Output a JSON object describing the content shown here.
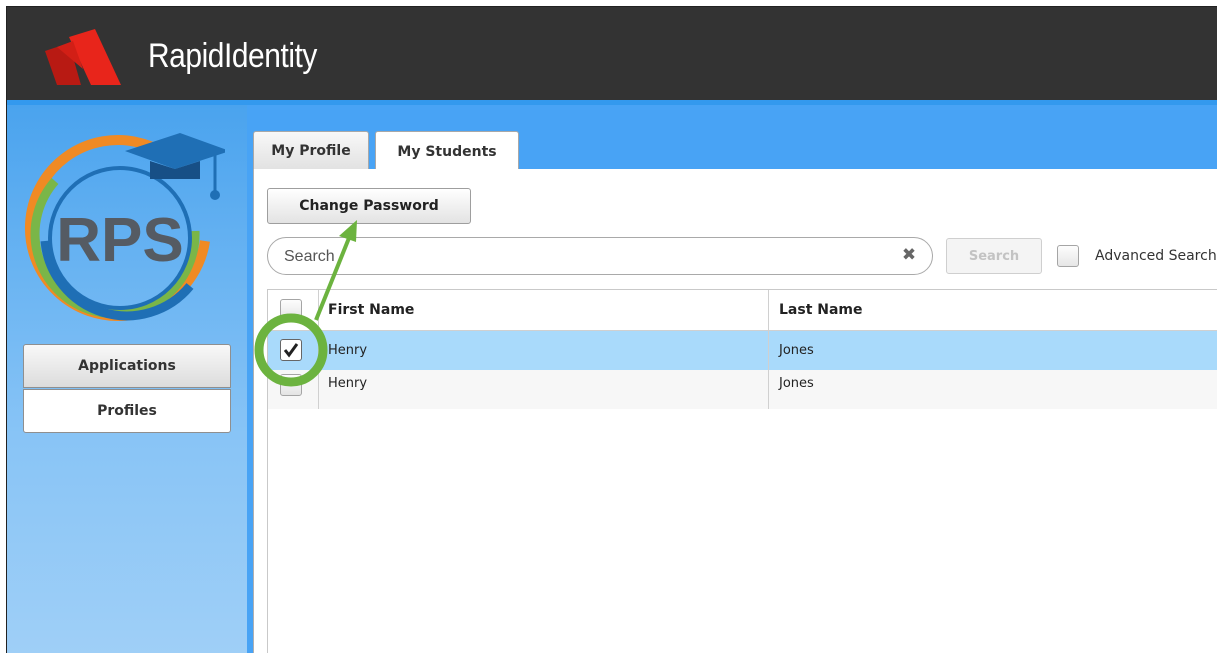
{
  "app": {
    "title": "RapidIdentity",
    "org_logo_text": "RPS"
  },
  "sidebar": {
    "items": [
      {
        "label": "Applications"
      },
      {
        "label": "Profiles"
      }
    ]
  },
  "tabs": [
    {
      "label": "My Profile",
      "active": false
    },
    {
      "label": "My Students",
      "active": true
    }
  ],
  "toolbar": {
    "change_password_label": "Change Password"
  },
  "search": {
    "placeholder": "Search",
    "button_label": "Search",
    "advanced_label": "Advanced Search"
  },
  "table": {
    "columns": [
      "First Name",
      "Last Name"
    ],
    "rows": [
      {
        "first": "Henry",
        "last": "Jones",
        "selected": true
      },
      {
        "first": "Henry",
        "last": "Jones",
        "selected": false
      }
    ]
  },
  "colors": {
    "topbar": "#333333",
    "brand_red": "#e8251b",
    "accent_blue": "#48a3f5",
    "selected_row": "#a9dafb",
    "annotation_green": "#6cb33f"
  }
}
